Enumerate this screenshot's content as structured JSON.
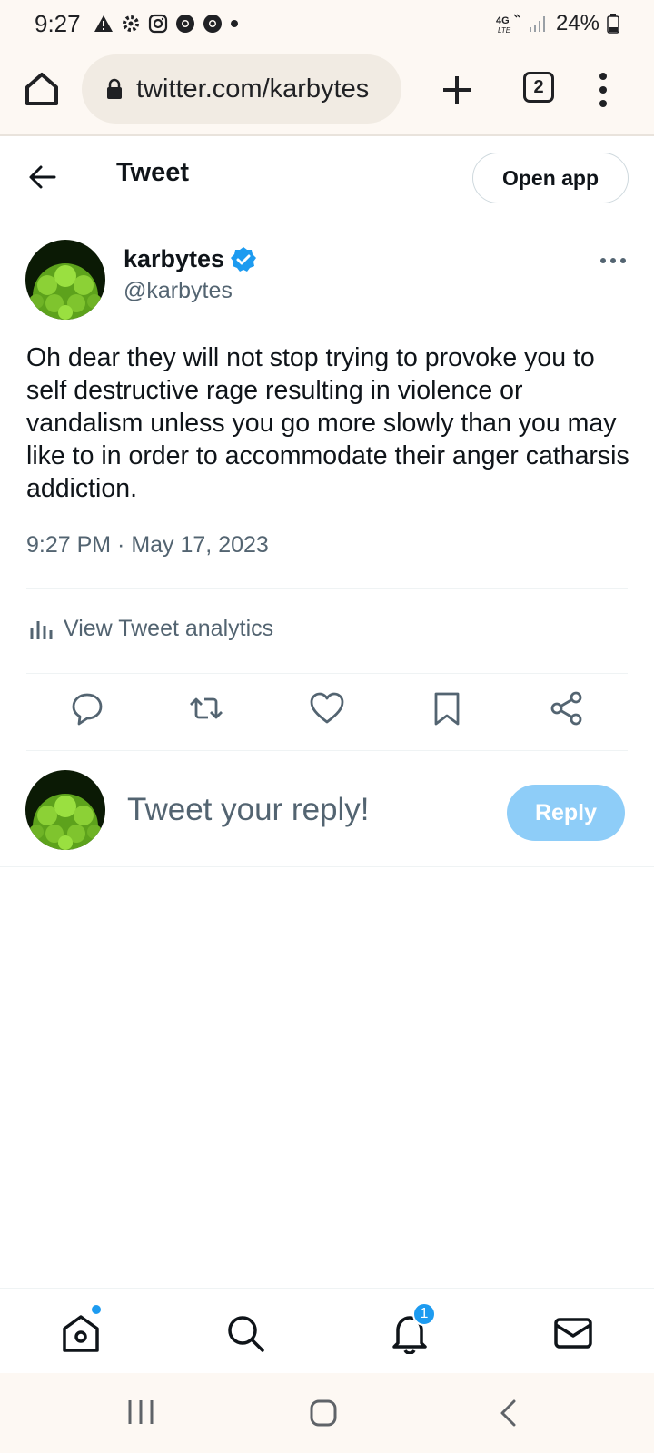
{
  "status_bar": {
    "time": "9:27",
    "network": "4G LTE",
    "battery": "24%"
  },
  "browser": {
    "url": "twitter.com/karbytes",
    "tab_count": "2"
  },
  "header": {
    "title": "Tweet",
    "open_app_label": "Open app"
  },
  "tweet": {
    "author_name": "karbytes",
    "author_handle": "@karbytes",
    "text": "Oh dear they will not stop trying to provoke you to self destructive rage resulting in violence or vandalism unless you go more slowly than you may like to in order to accommodate their anger catharsis addiction.",
    "timestamp": "9:27 PM · May 17, 2023",
    "analytics_label": "View Tweet analytics"
  },
  "reply": {
    "placeholder": "Tweet your reply!",
    "button_label": "Reply"
  },
  "bottom_nav": {
    "notification_count": "1"
  },
  "colors": {
    "accent": "#1d9bf0",
    "reply_button": "#8ecdf8",
    "secondary_text": "#536471"
  }
}
